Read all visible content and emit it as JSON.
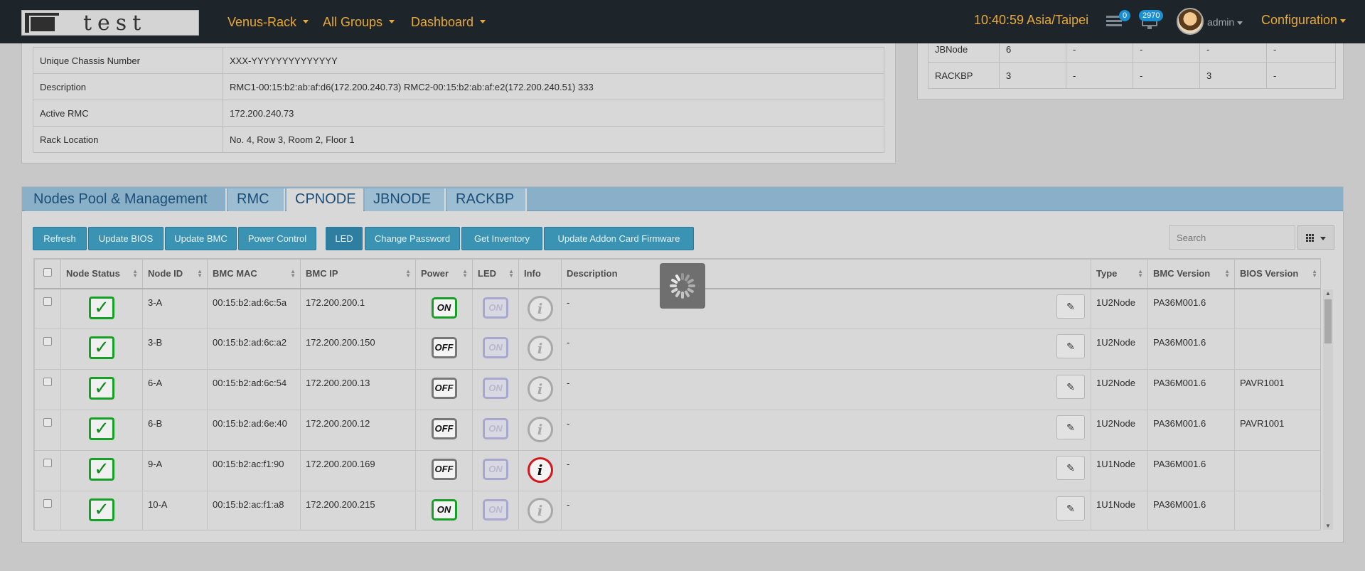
{
  "nav": {
    "logo_text": "test",
    "menus": [
      "Venus-Rack",
      "All Groups",
      "Dashboard"
    ],
    "clock": "10:40:59 Asia/Taipei",
    "messages_badge": "0",
    "alerts_badge": "2970",
    "user": "admin",
    "configuration": "Configuration"
  },
  "rack_info": {
    "rows": [
      {
        "label": "Unique Chassis Number",
        "value": "XXX-YYYYYYYYYYYYYY"
      },
      {
        "label": "Description",
        "value": "RMC1-00:15:b2:ab:af:d6(172.200.240.73) RMC2-00:15:b2:ab:af:e2(172.200.240.51) 333"
      },
      {
        "label": "Active RMC",
        "value": "172.200.240.73"
      },
      {
        "label": "Rack Location",
        "value": "No. 4, Row 3, Room 2, Floor 1"
      }
    ]
  },
  "summary": {
    "rows": [
      [
        "JBNode",
        "6",
        "-",
        "-",
        "-",
        "-"
      ],
      [
        "RACKBP",
        "3",
        "-",
        "-",
        "3",
        "-"
      ]
    ]
  },
  "tabs": [
    "Nodes Pool & Management",
    "RMC",
    "CPNODE",
    "JBNODE",
    "RACKBP"
  ],
  "toolbar": {
    "buttons": [
      "Refresh",
      "Update BIOS",
      "Update BMC",
      "Power Control",
      "LED",
      "Change Password",
      "Get Inventory",
      "Update Addon Card Firmware"
    ],
    "search_placeholder": "Search",
    "columns_icon": "grid-icon"
  },
  "table": {
    "headers": [
      "Node Status",
      "Node ID",
      "BMC MAC",
      "BMC IP",
      "Power",
      "LED",
      "Info",
      "Description",
      "Type",
      "BMC Version",
      "BIOS Version"
    ],
    "rows": [
      {
        "node_id": "3-A",
        "mac": "00:15:b2:ad:6c:5a",
        "ip": "172.200.200.1",
        "power": "ON",
        "led": "ON",
        "info_alert": false,
        "description": "-",
        "type": "1U2Node",
        "bmc_version": "PA36M001.6",
        "bios_version": ""
      },
      {
        "node_id": "3-B",
        "mac": "00:15:b2:ad:6c:a2",
        "ip": "172.200.200.150",
        "power": "OFF",
        "led": "ON",
        "info_alert": false,
        "description": "-",
        "type": "1U2Node",
        "bmc_version": "PA36M001.6",
        "bios_version": ""
      },
      {
        "node_id": "6-A",
        "mac": "00:15:b2:ad:6c:54",
        "ip": "172.200.200.13",
        "power": "OFF",
        "led": "ON",
        "info_alert": false,
        "description": "-",
        "type": "1U2Node",
        "bmc_version": "PA36M001.6",
        "bios_version": "PAVR1001"
      },
      {
        "node_id": "6-B",
        "mac": "00:15:b2:ad:6e:40",
        "ip": "172.200.200.12",
        "power": "OFF",
        "led": "ON",
        "info_alert": false,
        "description": "-",
        "type": "1U2Node",
        "bmc_version": "PA36M001.6",
        "bios_version": "PAVR1001"
      },
      {
        "node_id": "9-A",
        "mac": "00:15:b2:ac:f1:90",
        "ip": "172.200.200.169",
        "power": "OFF",
        "led": "ON",
        "info_alert": true,
        "description": "-",
        "type": "1U1Node",
        "bmc_version": "PA36M001.6",
        "bios_version": ""
      },
      {
        "node_id": "10-A",
        "mac": "00:15:b2:ac:f1:a8",
        "ip": "172.200.200.215",
        "power": "ON",
        "led": "ON",
        "info_alert": false,
        "description": "-",
        "type": "1U1Node",
        "bmc_version": "PA36M001.6",
        "bios_version": ""
      }
    ]
  },
  "colors": {
    "navbar": "#1d242a",
    "nav_text": "#e8a93a",
    "button": "#3b93b4",
    "status_ok": "#16a025",
    "info_alert": "#d3161c",
    "link": "#2f6ea6"
  }
}
